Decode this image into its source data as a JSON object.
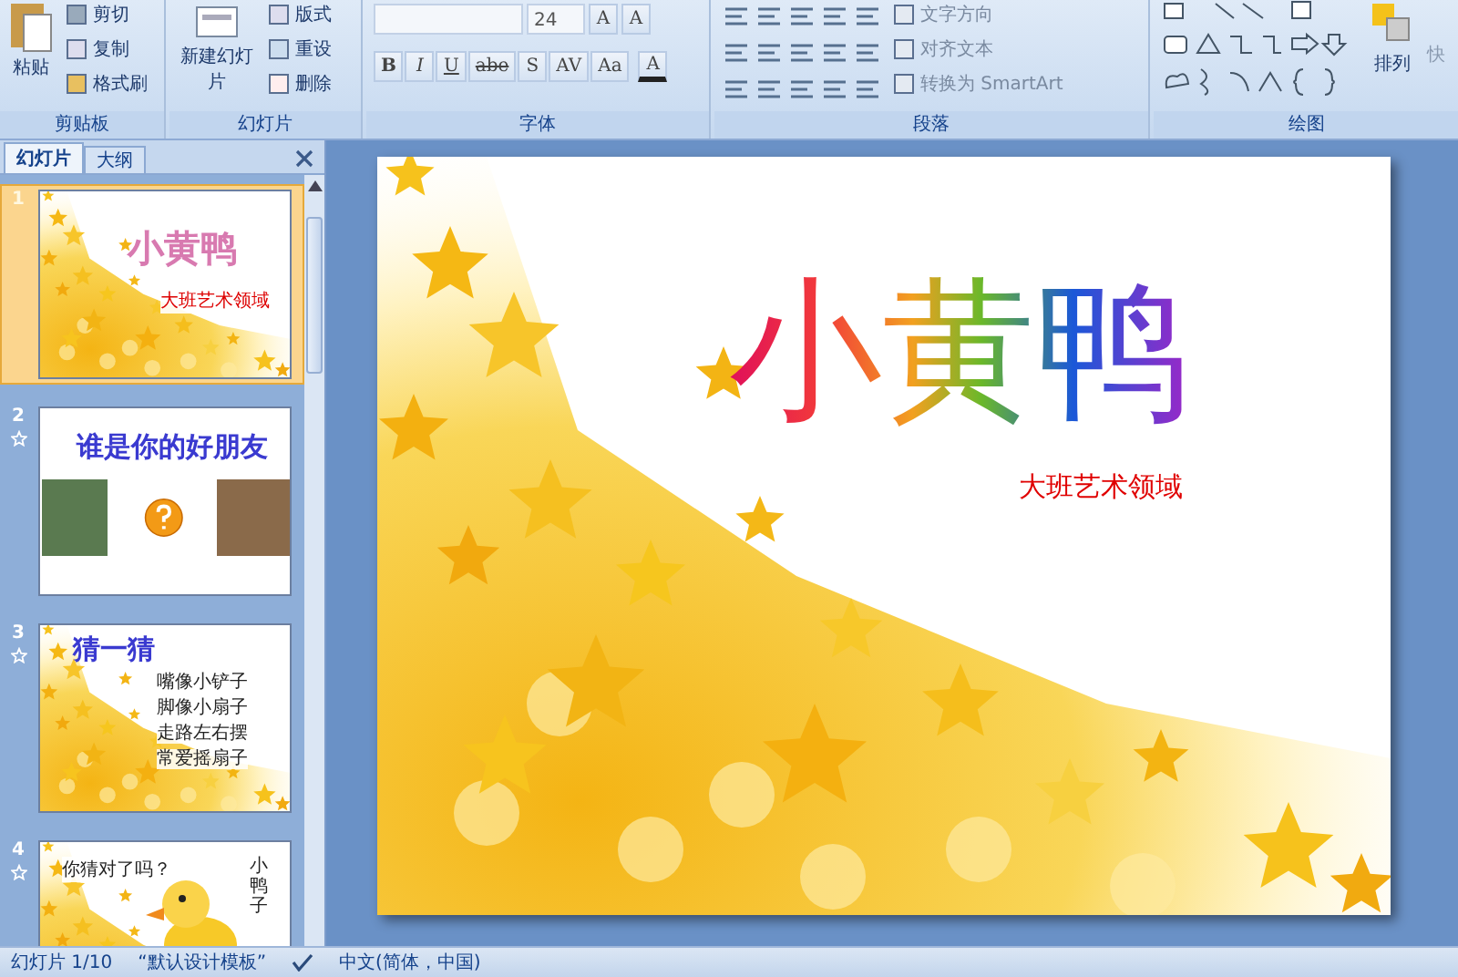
{
  "ribbon": {
    "clipboard": {
      "label": "剪贴板",
      "paste": "粘贴",
      "commands": [
        "剪切",
        "复制",
        "格式刷"
      ]
    },
    "slides": {
      "label": "幻灯片",
      "new_slide": "新建幻灯片",
      "commands": [
        "版式",
        "重设",
        "删除"
      ]
    },
    "font": {
      "label": "字体",
      "font_size": "24",
      "size_buttons": [
        "A",
        "A"
      ],
      "format_buttons": [
        "B",
        "I",
        "U",
        "abe",
        "S",
        "AV",
        "Aa"
      ],
      "color_button": "A"
    },
    "paragraph": {
      "label": "段落",
      "commands": [
        "文字方向",
        "对齐文本",
        "转换为 SmartArt"
      ]
    },
    "drawing": {
      "label": "绘图",
      "arrange": "排列",
      "quick_styles": "快"
    }
  },
  "panel": {
    "tabs": [
      {
        "label": "幻灯片",
        "selected": true
      },
      {
        "label": "大纲",
        "selected": false
      }
    ],
    "thumbnails": [
      {
        "number": "1",
        "kind": "title",
        "selected": true,
        "animated": false,
        "title": "小黄鸭",
        "subtitle": "大班艺术领域"
      },
      {
        "number": "2",
        "kind": "friends",
        "selected": false,
        "animated": true,
        "title": "谁是你的好朋友"
      },
      {
        "number": "3",
        "kind": "riddle",
        "selected": false,
        "animated": true,
        "title": "猜一猜",
        "lines": [
          "嘴像小铲子",
          "脚像小扇子",
          "走路左右摆",
          "常爱摇扇子"
        ]
      },
      {
        "number": "4",
        "kind": "duck",
        "selected": false,
        "animated": true,
        "question": "你猜对了吗？",
        "answer": "小鸭子"
      }
    ]
  },
  "slide": {
    "title": "小黄鸭",
    "subtitle": "大班艺术领域"
  },
  "status_bar": {
    "position": "幻灯片 1/10",
    "theme": "“默认设计模板”",
    "language": "中文(简体，中国)"
  }
}
